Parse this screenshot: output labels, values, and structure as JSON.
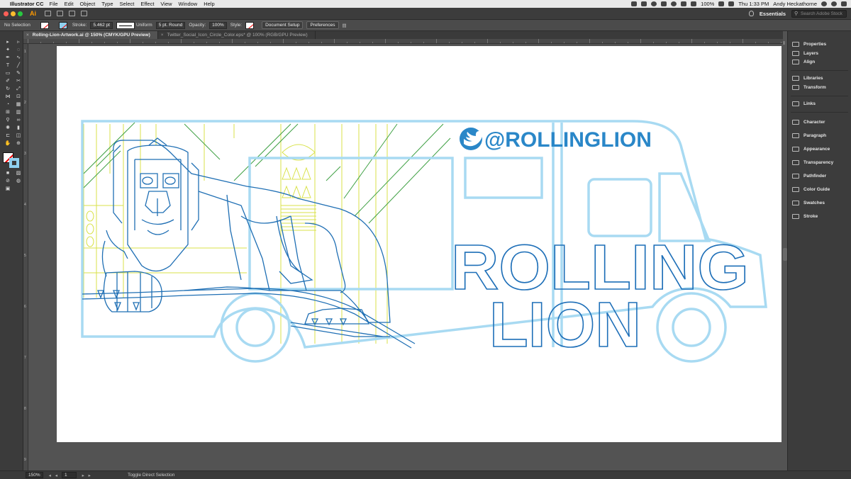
{
  "menubar": {
    "app_name": "Illustrator CC",
    "items": [
      "File",
      "Edit",
      "Object",
      "Type",
      "Select",
      "Effect",
      "View",
      "Window",
      "Help"
    ],
    "battery": "100%",
    "clock": "Thu 1:33 PM",
    "user": "Andy Heckathorne"
  },
  "appbar": {
    "logo": "Ai",
    "workspace": "Essentials",
    "search_placeholder": "Search Adobe Stock"
  },
  "controlbar": {
    "selection": "No Selection",
    "stroke_label": "Stroke:",
    "stroke_weight": "5.462 pt",
    "profile": "Uniform",
    "brush": "5 pt. Round",
    "opacity_label": "Opacity:",
    "opacity": "100%",
    "style_label": "Style:",
    "document_setup": "Document Setup",
    "preferences": "Preferences"
  },
  "tabs": [
    {
      "label": "Rolling-Lion-Artwork.ai @ 150% (CMYK/GPU Preview)",
      "active": true
    },
    {
      "label": "Twitter_Social_Icon_Circle_Color.eps* @ 100% (RGB/GPU Preview)",
      "active": false
    }
  ],
  "ruler": {
    "v_labels": [
      "1",
      "2",
      "3",
      "4",
      "5",
      "6",
      "7",
      "8",
      "9"
    ]
  },
  "artwork": {
    "handle": "@ROLLINGLION",
    "title_line1": "ROLLING",
    "title_line2": "LION",
    "colors": {
      "truck": "#a8daf2",
      "lion": "#1f6fb4",
      "yellow": "#d9e24a",
      "green": "#3ea043",
      "twitter": "#2a87c8",
      "text": "#1e6fb8"
    }
  },
  "panels": {
    "group1": [
      "Properties",
      "Layers",
      "Align"
    ],
    "group2": [
      "Libraries",
      "Transform"
    ],
    "group3": [
      "Links"
    ],
    "group4": [
      "Character",
      "Paragraph",
      "Appearance",
      "Transparency",
      "Pathfinder",
      "Color Guide",
      "Swatches",
      "Stroke"
    ]
  },
  "statusbar": {
    "zoom": "150%",
    "page": "1",
    "status": "Toggle Direct Selection"
  }
}
